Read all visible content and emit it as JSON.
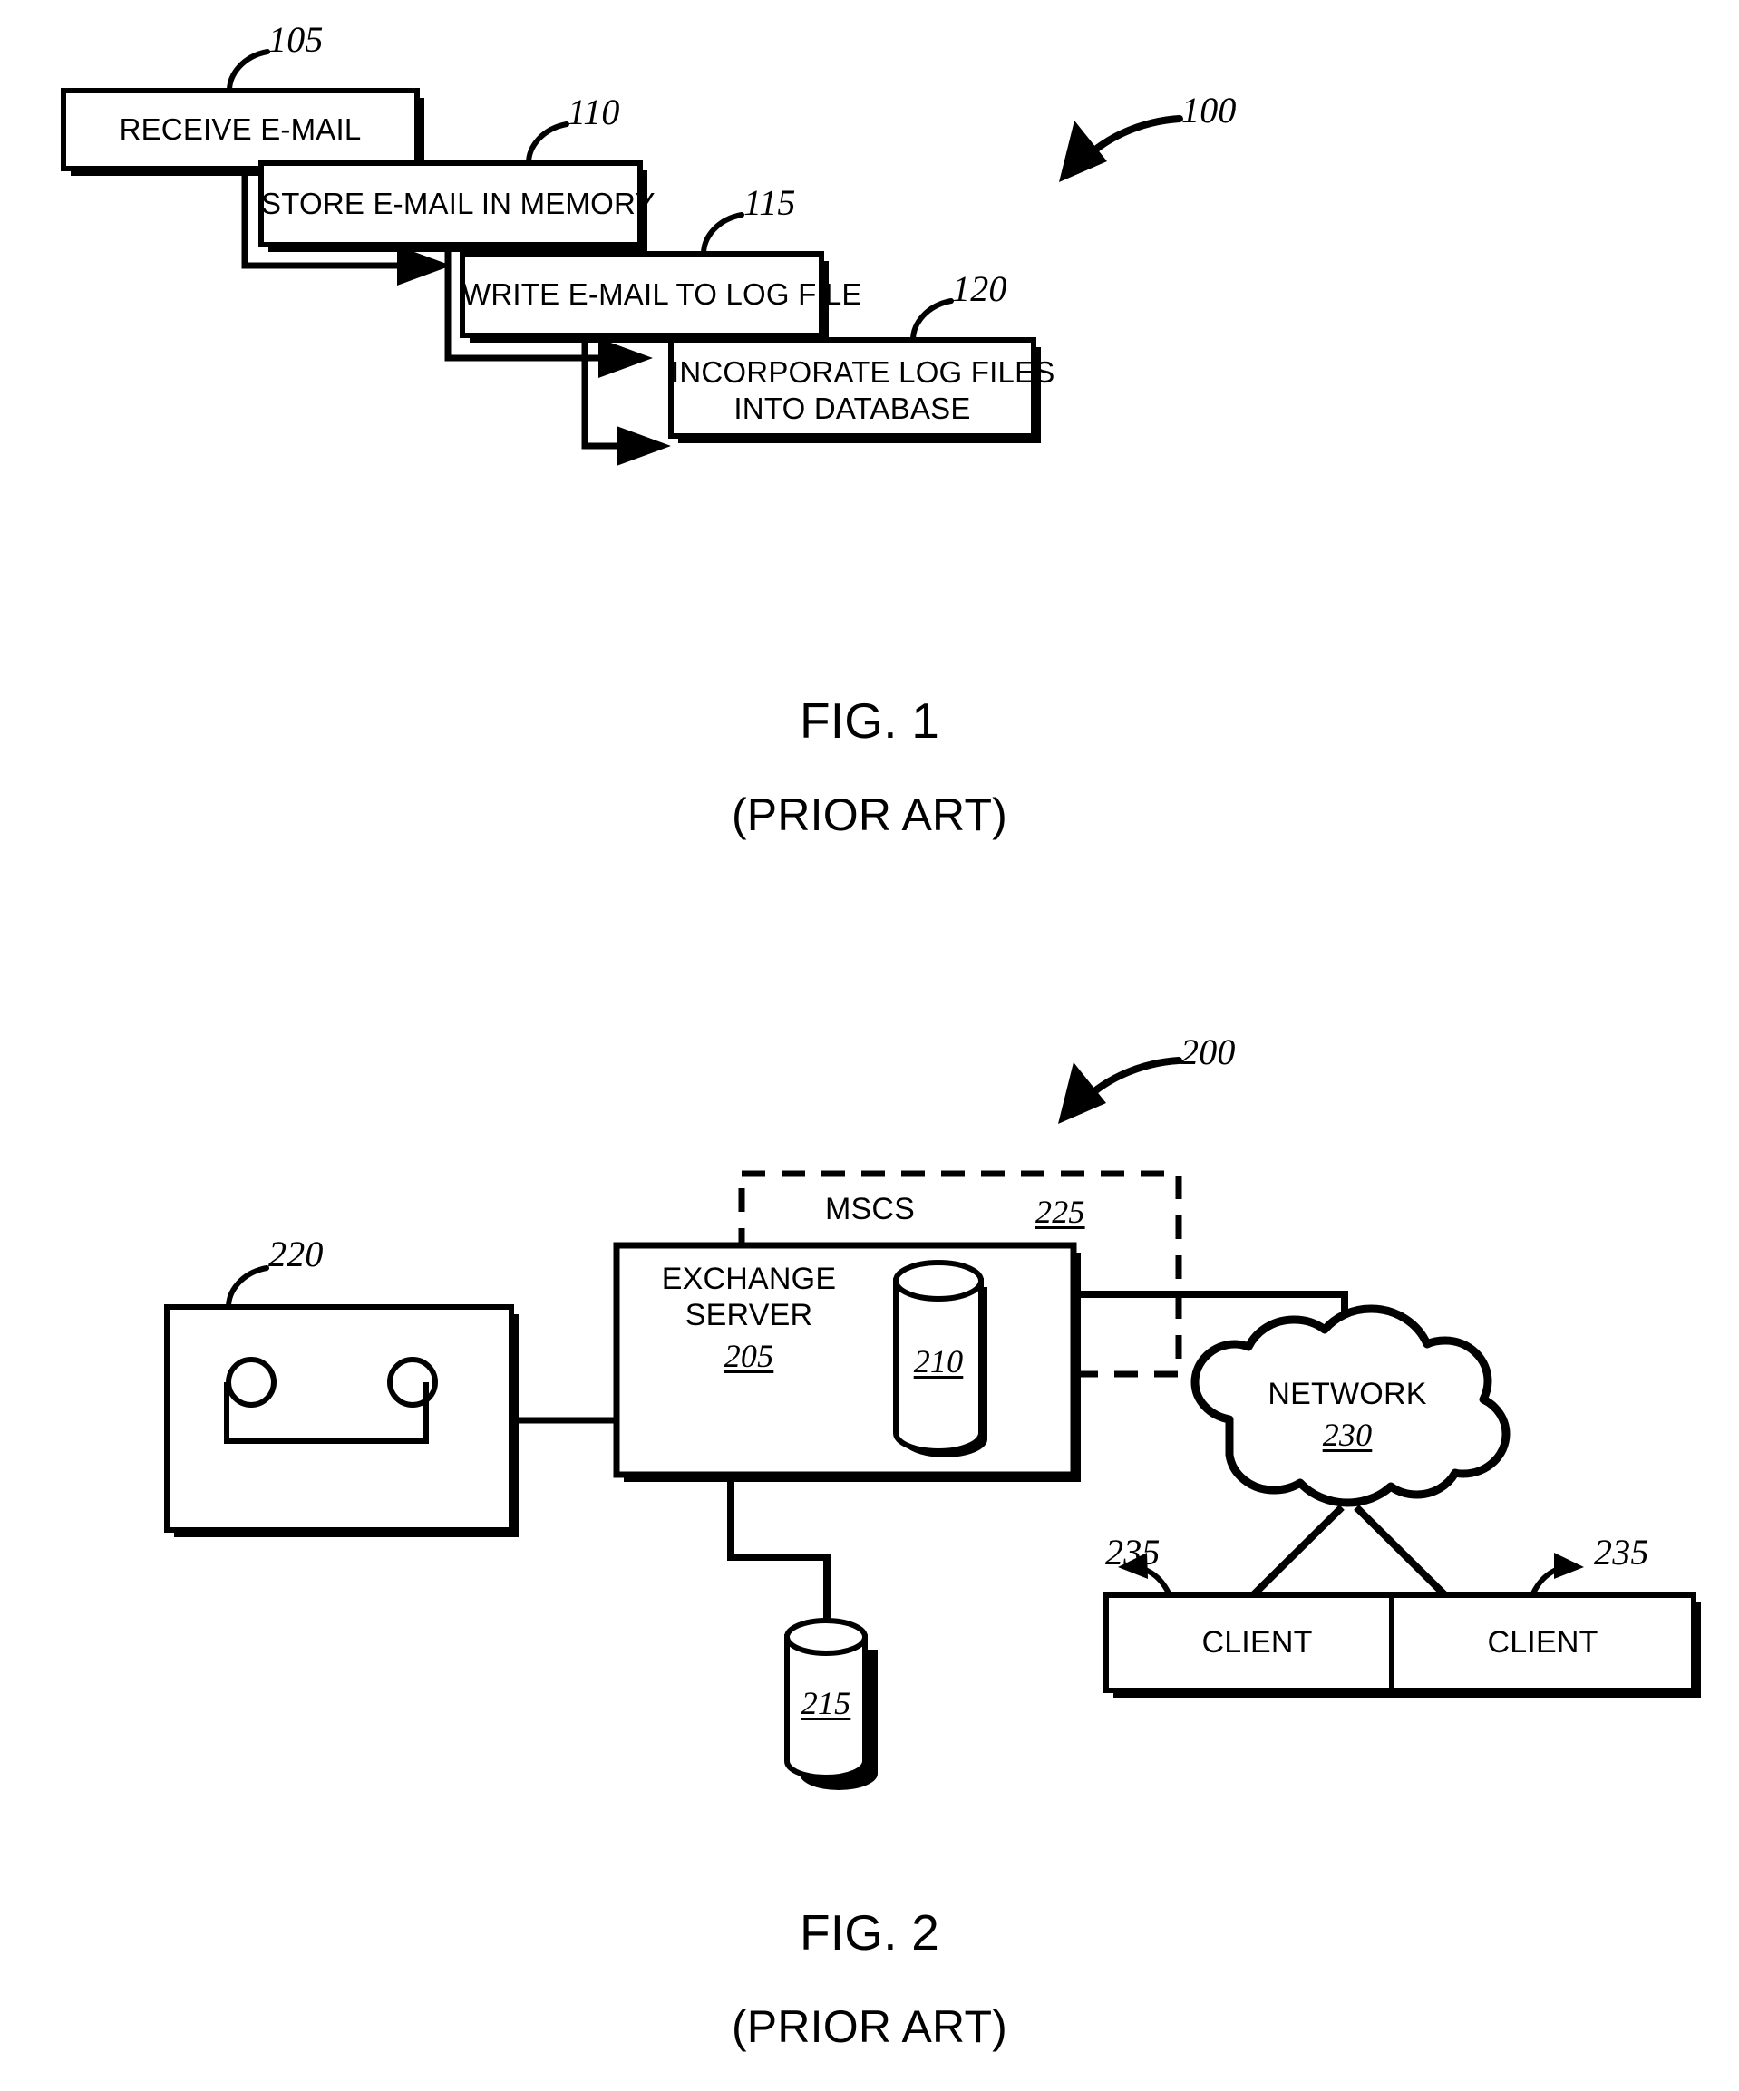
{
  "document": {
    "type": "patent-drawing-sheet",
    "figures": [
      {
        "id": "fig1",
        "caption": "FIG. 1",
        "subcaption": "(PRIOR ART)",
        "system_ref": "100",
        "steps": [
          {
            "ref": "105",
            "label": "RECEIVE E-MAIL"
          },
          {
            "ref": "110",
            "label": "STORE E-MAIL IN MEMORY"
          },
          {
            "ref": "115",
            "label": "WRITE E-MAIL TO LOG FILE"
          },
          {
            "ref": "120",
            "label_line1": "INCORPORATE LOG FILES",
            "label_line2": "INTO DATABASE"
          }
        ]
      },
      {
        "id": "fig2",
        "caption": "FIG. 2",
        "subcaption": "(PRIOR ART)",
        "system_ref": "200",
        "nodes": [
          {
            "name": "tape-drive",
            "ref": "220",
            "label": ""
          },
          {
            "name": "exchange-server",
            "ref": "205",
            "label_line1": "EXCHANGE",
            "label_line2": "SERVER"
          },
          {
            "name": "server-database",
            "ref": "210",
            "label": ""
          },
          {
            "name": "storage-database",
            "ref": "215",
            "label": ""
          },
          {
            "name": "mscs-cluster",
            "ref": "225",
            "label": "MSCS"
          },
          {
            "name": "network-cloud",
            "ref": "230",
            "label": "NETWORK"
          },
          {
            "name": "client-left",
            "ref": "235",
            "label": "CLIENT"
          },
          {
            "name": "client-right",
            "ref": "235",
            "label": "CLIENT"
          }
        ]
      }
    ]
  },
  "colors": {
    "ink": "#000000",
    "paper": "#ffffff"
  }
}
